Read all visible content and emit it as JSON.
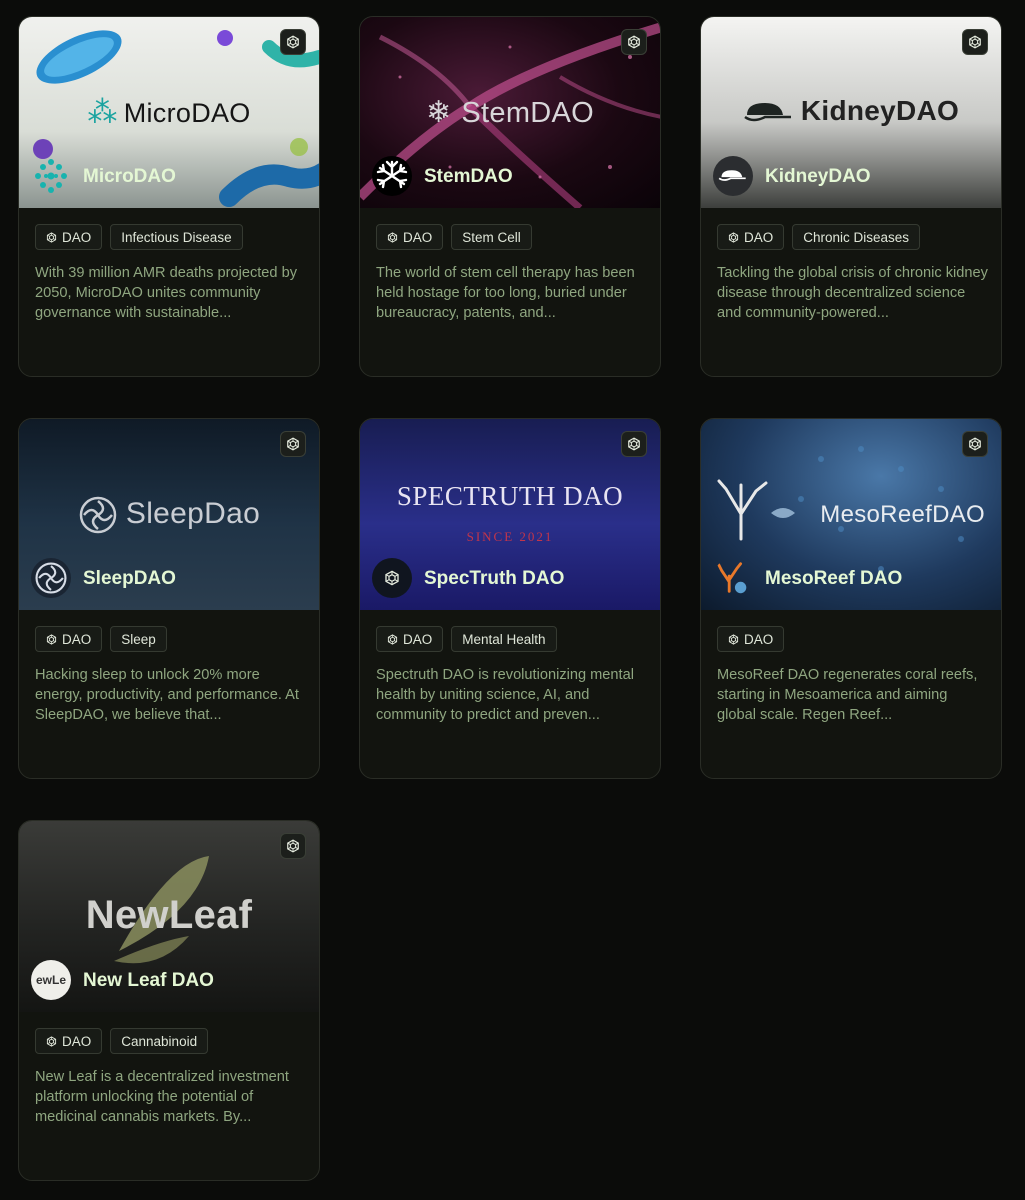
{
  "cards": [
    {
      "name": "MicroDAO",
      "logo_text": "MicroDAO",
      "tags": [
        "DAO",
        "Infectious Disease"
      ],
      "description": "With 39 million AMR deaths projected by 2050, MicroDAO unites community governance with sustainable..."
    },
    {
      "name": "StemDAO",
      "logo_text": "StemDAO",
      "tags": [
        "DAO",
        "Stem Cell"
      ],
      "description": "The world of stem cell therapy has been held hostage for too long, buried under bureaucracy, patents, and..."
    },
    {
      "name": "KidneyDAO",
      "logo_text": "KidneyDAO",
      "tags": [
        "DAO",
        "Chronic Diseases"
      ],
      "description": "Tackling the global crisis of chronic kidney disease through decentralized science and community-powered..."
    },
    {
      "name": "SleepDAO",
      "logo_text": "SleepDao",
      "tags": [
        "DAO",
        "Sleep"
      ],
      "description": "Hacking sleep to unlock 20% more energy, productivity, and performance. At SleepDAO, we believe that..."
    },
    {
      "name": "SpecTruth DAO",
      "logo_text": "SPECTRUTH DAO",
      "logo_subtext": "SINCE 2021",
      "tags": [
        "DAO",
        "Mental Health"
      ],
      "description": "Spectruth DAO is revolutionizing mental health by uniting science, AI, and community to predict and preven..."
    },
    {
      "name": "MesoReef DAO",
      "logo_text": "MesoReefDAO",
      "tags": [
        "DAO"
      ],
      "description": "MesoReef DAO regenerates coral reefs, starting in Mesoamerica and aiming global scale. Regen Reef..."
    },
    {
      "name": "New Leaf DAO",
      "logo_text": "NewLeaf",
      "avatar_text": "ewLe",
      "tags": [
        "DAO",
        "Cannabinoid"
      ],
      "description": "New Leaf is a decentralized investment platform unlocking the potential of medicinal cannabis markets. By..."
    }
  ],
  "colors": {
    "page_bg": "#0b0c0a",
    "card_bg": "#12140f",
    "name_color": "#e4f7d4",
    "desc_color": "#8fa680",
    "tag_border": "#353a31"
  },
  "icons": {
    "chain": "cube-hexagon-icon",
    "tag": "cube-hexagon-icon"
  }
}
